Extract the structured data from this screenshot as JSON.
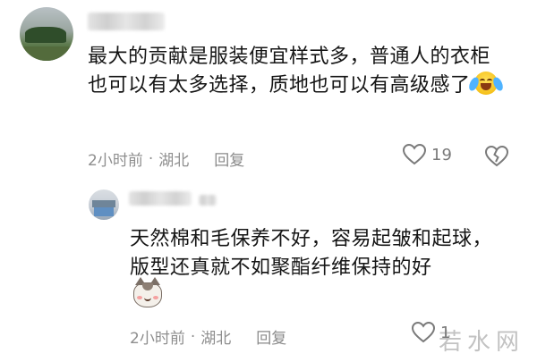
{
  "comments": [
    {
      "text": "最大的贡献是服装便宜样式多，普通人的衣柜也可以有太多选择，质地也可以有高级感了",
      "emoji": "laughing-crying-emoji",
      "time": "2小时前",
      "location": "湖北",
      "reply_label": "回复",
      "likes": "19"
    },
    {
      "text": "天然棉和毛保养不好，容易起皱和起球，版型还真就不如聚酯纤维保持的好",
      "emoji": "cat-face-emoji",
      "time": "2小时前",
      "location": "湖北",
      "reply_label": "回复",
      "likes": "1"
    }
  ],
  "separator": "·",
  "watermark": "若水网",
  "colors": {
    "text": "#151515",
    "meta": "#8e8e8e",
    "icon": "#7a7a7a"
  }
}
